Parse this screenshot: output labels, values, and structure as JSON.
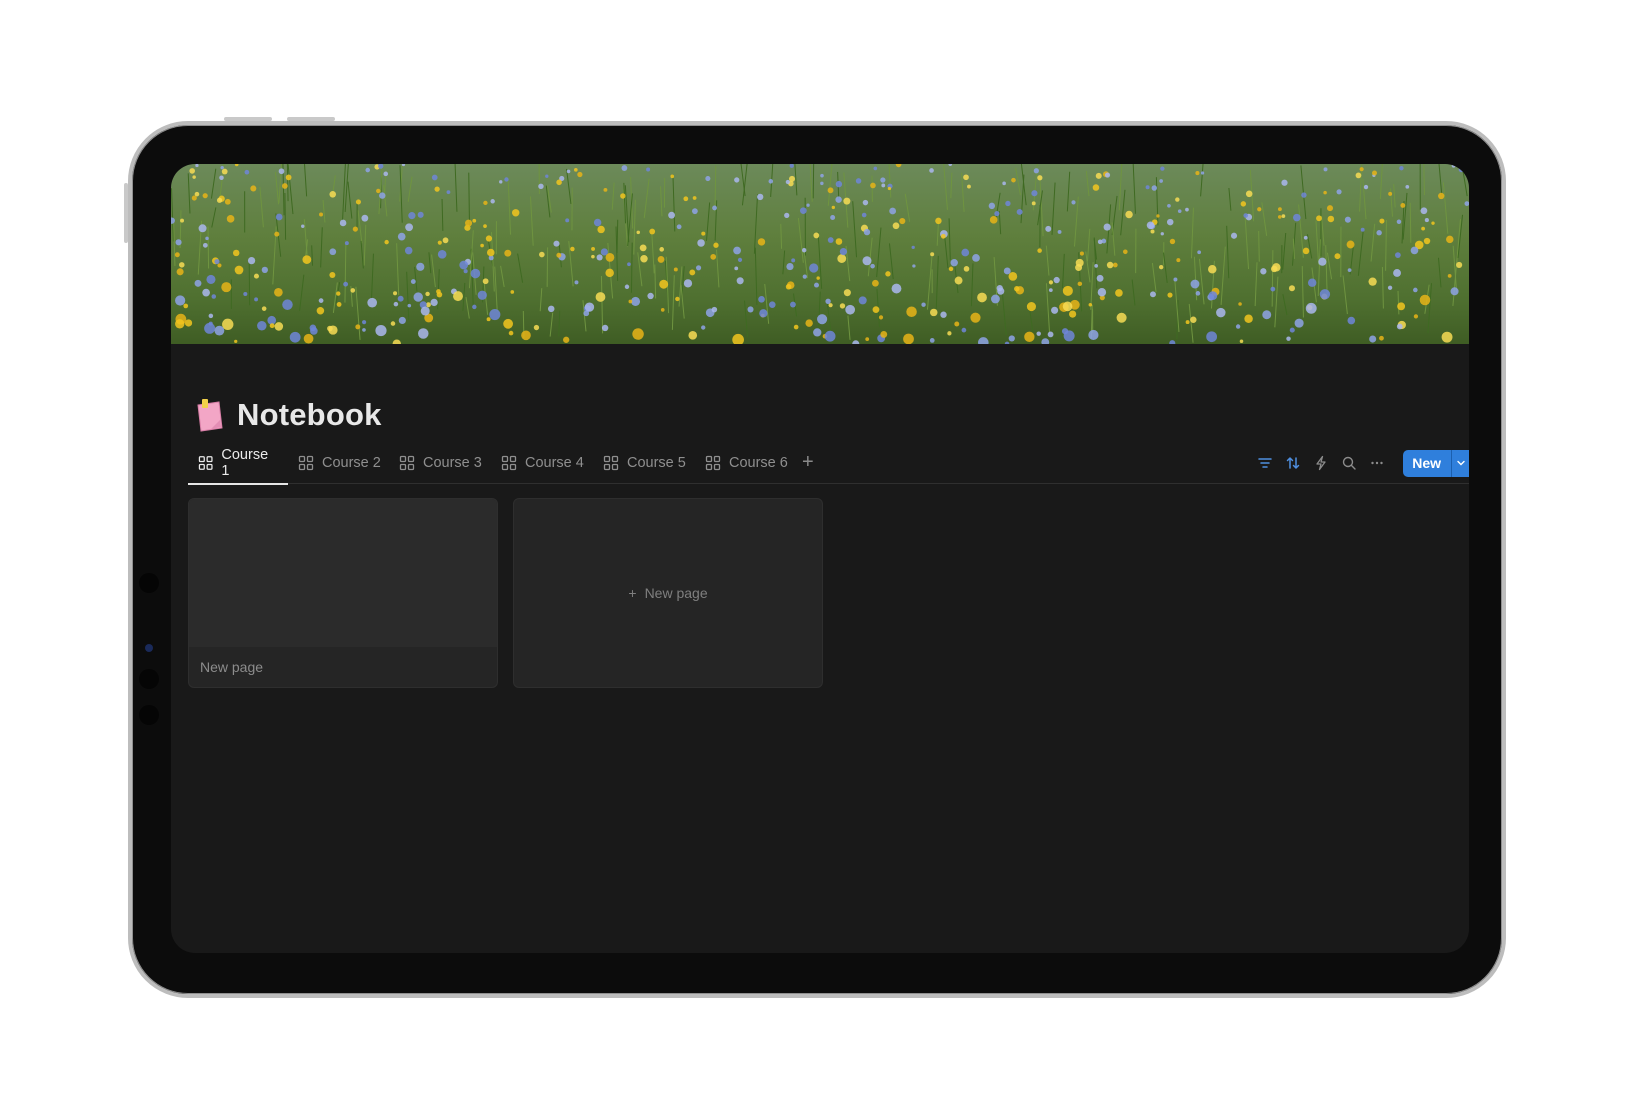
{
  "page": {
    "title": "Notebook",
    "emoji": "pink-note-icon"
  },
  "tabs": [
    {
      "label": "Course 1",
      "active": true
    },
    {
      "label": "Course 2",
      "active": false
    },
    {
      "label": "Course 3",
      "active": false
    },
    {
      "label": "Course 4",
      "active": false
    },
    {
      "label": "Course 5",
      "active": false
    },
    {
      "label": "Course 6",
      "active": false
    }
  ],
  "tab_add_label": "+",
  "toolbar": {
    "icons": [
      "filter-icon",
      "sort-icon",
      "automation-icon",
      "search-icon",
      "more-icon"
    ],
    "new_label": "New"
  },
  "cards": [
    {
      "title": "New page"
    }
  ],
  "new_page_card": {
    "label": "New page",
    "plus": "+"
  },
  "colors": {
    "background": "#191919",
    "accent": "#2f7fdc",
    "icon_blue": "#4f8fe0"
  }
}
